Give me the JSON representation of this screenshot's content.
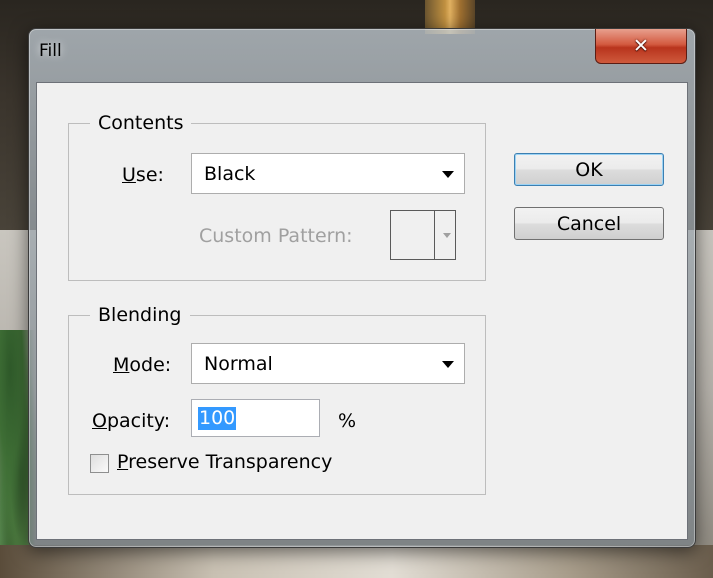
{
  "window": {
    "title": "Fill",
    "close_icon": "close-icon",
    "close_glyph": "✕"
  },
  "contents": {
    "legend": "Contents",
    "use_label_prefix": "",
    "use_label_access": "U",
    "use_label_rest": "se:",
    "use_value": "Black",
    "custom_pattern_label": "Custom Pattern:"
  },
  "blending": {
    "legend": "Blending",
    "mode_label_access": "M",
    "mode_label_rest": "ode:",
    "mode_value": "Normal",
    "opacity_label_access": "O",
    "opacity_label_rest": "pacity:",
    "opacity_value": "100",
    "opacity_unit": "%",
    "preserve_label_access": "P",
    "preserve_label_rest": "reserve Transparency",
    "preserve_checked": false
  },
  "buttons": {
    "ok": "OK",
    "cancel": "Cancel"
  },
  "colors": {
    "selection": "#3399ff",
    "close_button": "#c8462c",
    "default_button_border": "#3c7fb1"
  }
}
